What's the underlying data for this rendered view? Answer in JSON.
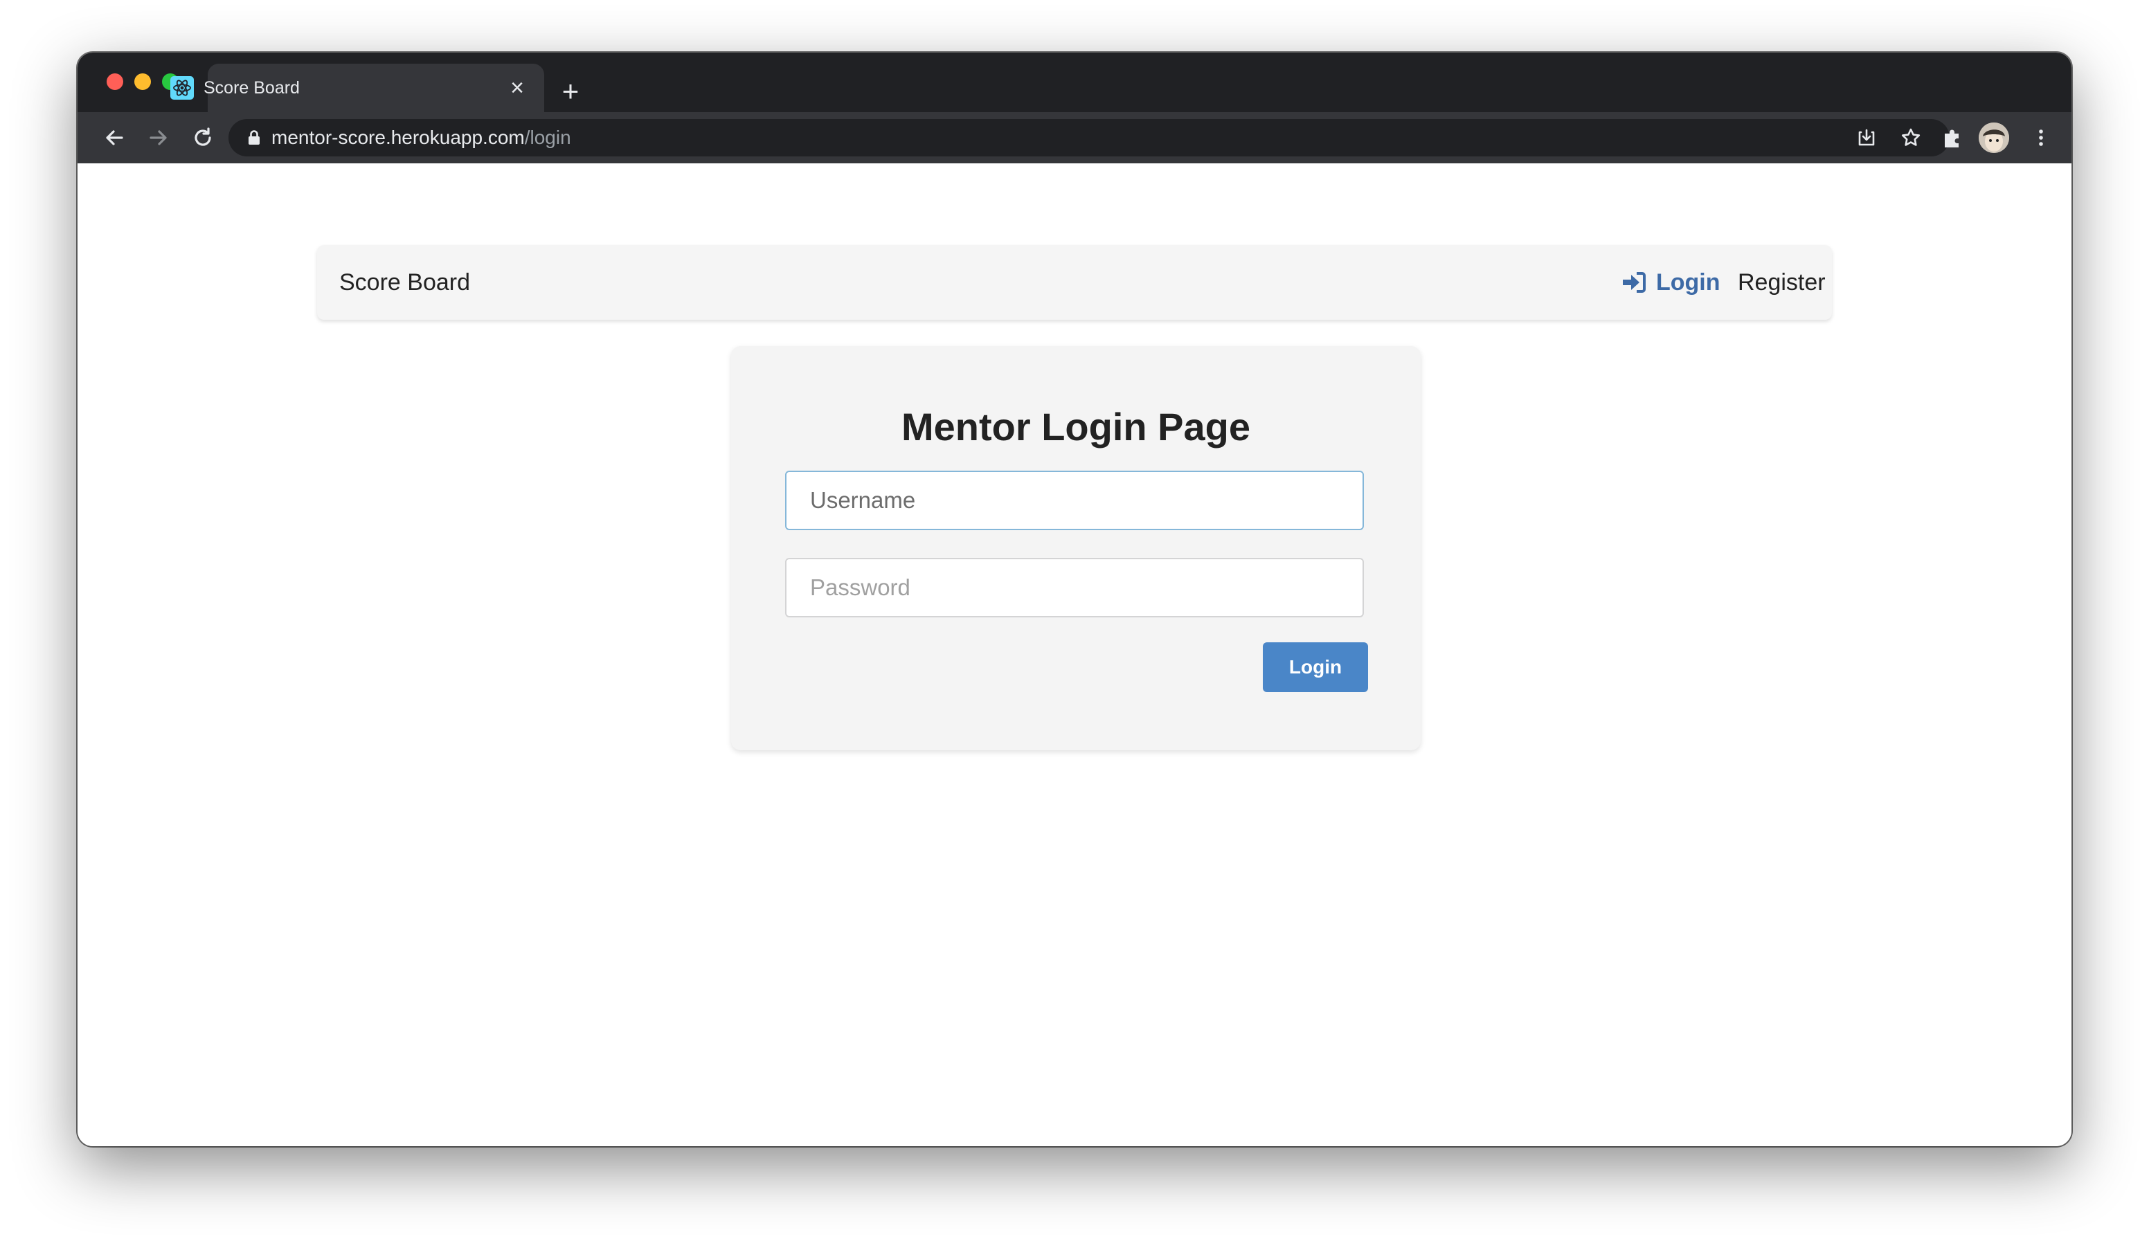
{
  "browser": {
    "tab_title": "Score Board",
    "tab_close": "×",
    "new_tab": "+",
    "url_host": "mentor-score.herokuapp.com",
    "url_path": "/login",
    "icons": [
      "back-icon",
      "forward-icon",
      "reload-icon",
      "lock-icon",
      "install-icon",
      "star-icon",
      "extensions-icon",
      "avatar",
      "menu-icon"
    ]
  },
  "navbar": {
    "brand": "Score Board",
    "login_label": "Login",
    "register_label": "Register"
  },
  "login_card": {
    "title": "Mentor Login Page",
    "username_placeholder": "Username",
    "password_placeholder": "Password",
    "submit_label": "Login"
  },
  "colors": {
    "accent": "#4a86c8",
    "nav_link_active": "#3d6aa6",
    "browser_dark": "#202124"
  }
}
